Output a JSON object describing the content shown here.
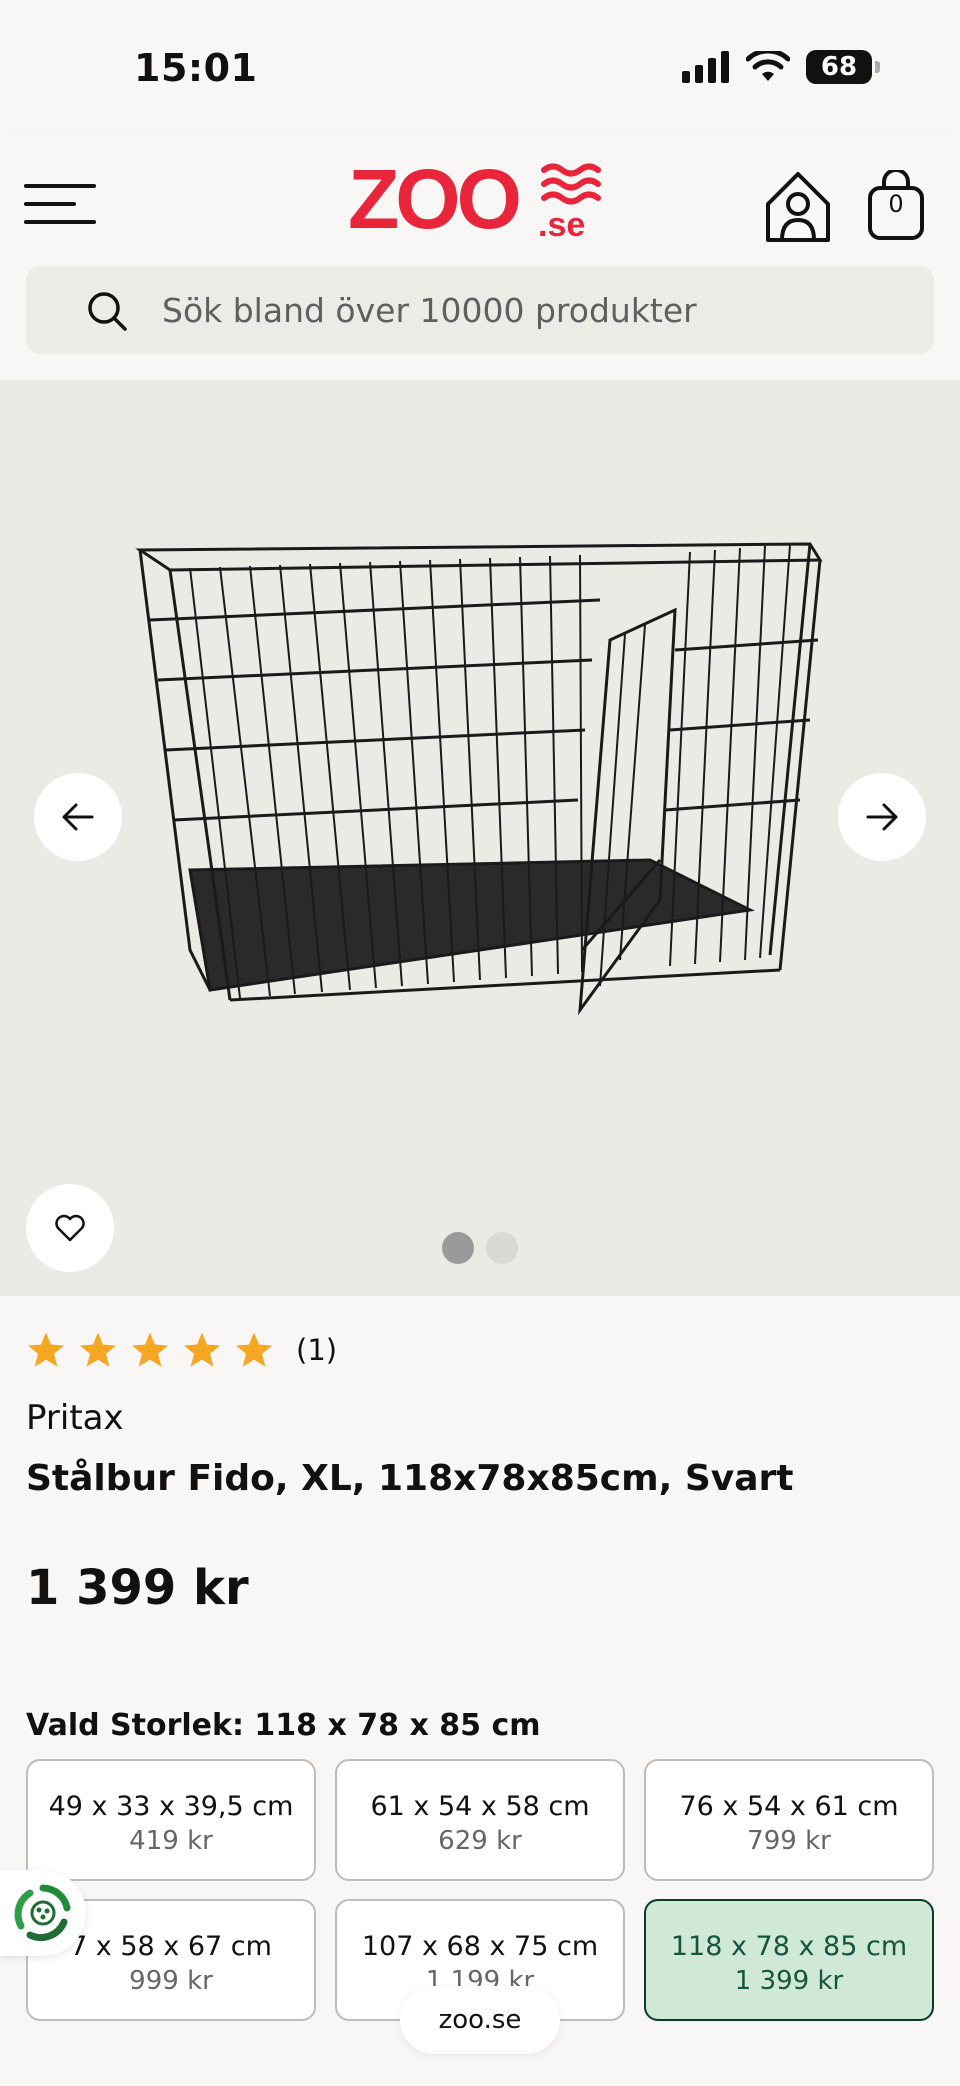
{
  "status_bar": {
    "time": "15:01",
    "battery": "68"
  },
  "header": {
    "logo": {
      "text": "ZOO",
      "suffix": ".se",
      "color": "#e8253a"
    },
    "cart_count": "0",
    "search_placeholder": "Sök bland över 10000 produkter"
  },
  "gallery": {
    "image_count": 2,
    "active_index": 0,
    "image_subject": "black wire dog cage"
  },
  "product": {
    "rating_stars": 5,
    "rating_count": "(1)",
    "brand": "Pritax",
    "title": "Stålbur Fido, XL, 118x78x85cm, Svart",
    "price": "1 399 kr",
    "selected_size_label": "Vald Storlek: 118 x 78 x 85 cm",
    "sizes": [
      {
        "dimensions": "49 x 33 x 39,5 cm",
        "price": "419 kr"
      },
      {
        "dimensions": "61 x 54 x 58 cm",
        "price": "629 kr"
      },
      {
        "dimensions": "76 x 54 x 61 cm",
        "price": "799 kr"
      },
      {
        "dimensions": "7 x 58 x 67 cm",
        "price": "999 kr"
      },
      {
        "dimensions": "107 x 68 x 75 cm",
        "price": "1 199 kr"
      },
      {
        "dimensions": "118 x 78 x 85 cm",
        "price": "1 399 kr",
        "selected": true
      }
    ]
  },
  "browser": {
    "url": "zoo.se"
  },
  "colors": {
    "accent_red": "#e8253a",
    "star": "#f5a623",
    "selected_bg": "#cfe9d6",
    "selected_border": "#0b3b2a",
    "recycle_green": "#1f8a3a"
  },
  "icons": [
    "menu-icon",
    "account-icon",
    "cart-icon",
    "search-icon",
    "arrow-left-icon",
    "arrow-right-icon",
    "heart-icon",
    "star-icon",
    "recycle-icon"
  ]
}
